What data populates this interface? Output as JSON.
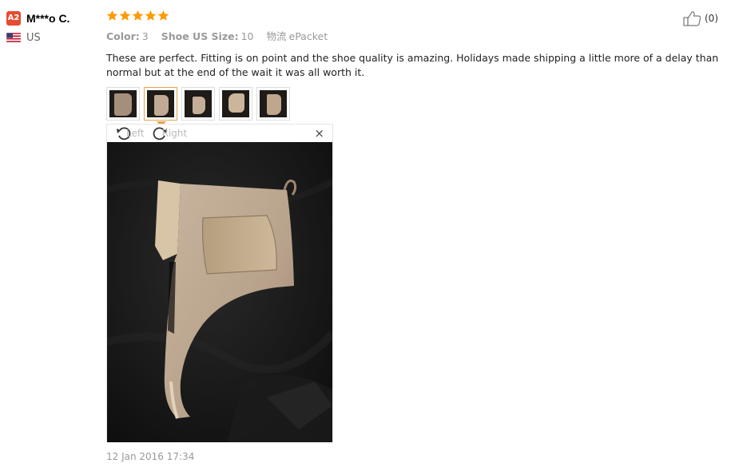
{
  "reviewer": {
    "level_badge": "A2",
    "name": "M***o C.",
    "country": "US",
    "flag_icon": "us-flag-icon"
  },
  "review": {
    "rating": 5,
    "attributes": [
      {
        "key": "Color:",
        "value": "3"
      },
      {
        "key": "Shoe US Size:",
        "value": "10"
      },
      {
        "key": "物流",
        "value": "ePacket"
      }
    ],
    "text": "These are perfect. Fitting is on point and the shoe quality is amazing. Holidays made shipping a little more of a delay than normal but at the end of the wait it was all worth it.",
    "thumbnails_count": 5,
    "active_thumbnail": 2,
    "date": "12 Jan 2016 17:34"
  },
  "viewer": {
    "rotate_left_label": "Left",
    "rotate_right_label": "Right",
    "close_glyph": "×",
    "photo_alt": "Customer photo of a suede chelsea boot"
  },
  "helpful": {
    "count": "(0)",
    "icon": "thumbs-up-icon"
  },
  "colors": {
    "star": "#ff9a00",
    "badge": "#e64b2e",
    "active_thumb_border": "#e5a44c"
  }
}
